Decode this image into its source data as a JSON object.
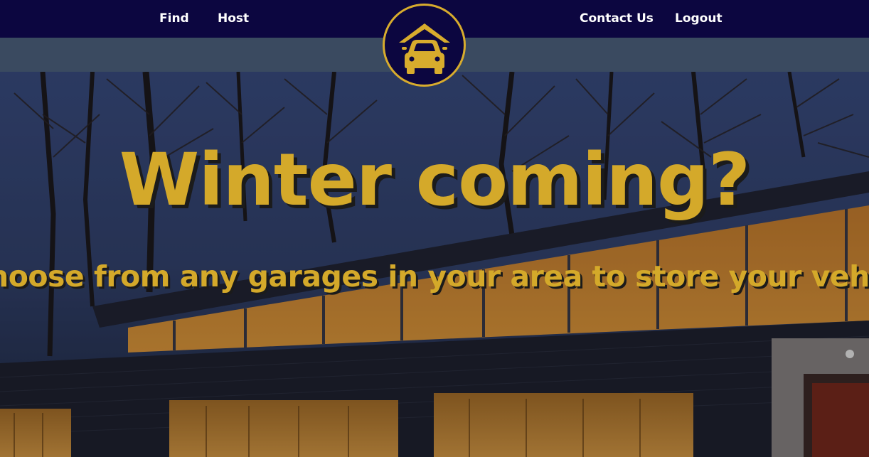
{
  "nav": {
    "find_label": "Find",
    "host_label": "Host",
    "contact_label": "Contact Us",
    "logout_label": "Logout"
  },
  "logo": {
    "icon": "garage-car-icon"
  },
  "hero": {
    "headline": "Winter coming?",
    "subheadline": "hoose from any garages in your area to store your vehic"
  },
  "colors": {
    "nav_bg": "#0c0640",
    "subbar_bg": "#3a4a60",
    "accent_gold": "#d4a92a",
    "nav_text": "#ffffff"
  }
}
